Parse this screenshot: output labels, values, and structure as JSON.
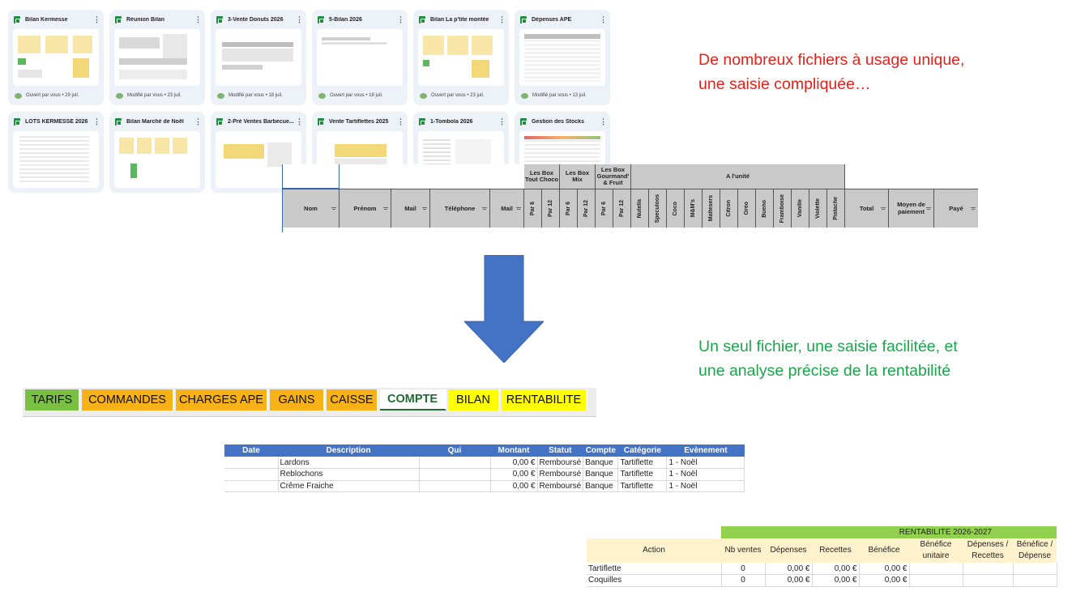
{
  "drive_files": [
    {
      "title": "Bilan Kermesse",
      "meta": "Ouvert par vous • 29 juil."
    },
    {
      "title": "Réunion Bilan",
      "meta": "Modifié par vous • 23 juil."
    },
    {
      "title": "3-Vente Donuts 2026",
      "meta": "Modifié par vous • 18 juil."
    },
    {
      "title": "5-Bilan 2026",
      "meta": "Ouvert par vous • 18 juil."
    },
    {
      "title": "Bilan La p'tite montée",
      "meta": "Ouvert par vous • 23 juil."
    },
    {
      "title": "Dépenses APE",
      "meta": "Modifié par vous • 13 juil."
    },
    {
      "title": "LOTS KERMESSE 2026",
      "meta": ""
    },
    {
      "title": "Bilan Marché de Noël",
      "meta": ""
    },
    {
      "title": "2-Pré Ventes Barbecue...",
      "meta": ""
    },
    {
      "title": "Vente Tartiflettes 2025",
      "meta": ""
    },
    {
      "title": "1-Tombola 2026",
      "meta": ""
    },
    {
      "title": "Gestion des Stocks",
      "meta": ""
    }
  ],
  "order_sheet": {
    "groups": [
      "Les Box Tout Choco",
      "Les Box Mix",
      "Les Box Gourmand' & Fruit",
      "A l'unité"
    ],
    "columns": [
      "Nom",
      "Prénom",
      "Mail",
      "Téléphone",
      "Mail",
      "Par 6",
      "Par 12",
      "Par 6",
      "Par 12",
      "Par 6",
      "Par 12",
      "Nutella",
      "Speculoos",
      "Coco",
      "M&M's",
      "Maltesers",
      "Citron",
      "Oréo",
      "Bueno",
      "Framboise",
      "Vanille",
      "Violette",
      "Pistache",
      "Total",
      "Moyen de paiement",
      "Payé"
    ]
  },
  "captions": {
    "before_line1": "De nombreux fichiers à usage unique,",
    "before_line2": "une saisie compliquée…",
    "after_line1": "Un seul fichier, une saisie facilitée, et",
    "after_line2": "une analyse précise de la rentabilité"
  },
  "tabs": [
    "TARIFS",
    "COMMANDES",
    "CHARGES APE",
    "GAINS",
    "CAISSE",
    "COMPTE",
    "BILAN",
    "RENTABILITE"
  ],
  "compte": {
    "headers": [
      "Date",
      "Description",
      "Qui",
      "Montant",
      "Statut",
      "Compte",
      "Catégorie",
      "Evènement"
    ],
    "rows": [
      [
        "",
        "Lardons",
        "",
        "0,00 €",
        "Remboursé",
        "Banque",
        "Tartiflette",
        "1 - Noël"
      ],
      [
        "",
        "Reblochons",
        "",
        "0,00 €",
        "Remboursé",
        "Banque",
        "Tartiflette",
        "1 - Noël"
      ],
      [
        "",
        "Crême Fraiche",
        "",
        "0,00 €",
        "Remboursé",
        "Banque",
        "Tartiflette",
        "1 - Noël"
      ]
    ]
  },
  "rentabilite": {
    "title": "RENTABILITE 2026-2027",
    "headers": [
      "Action",
      "Nb ventes",
      "Dépenses",
      "Recettes",
      "Bénéfice",
      "Bénéfice unitaire",
      "Dépenses / Recettes",
      "Bénéfice / Dépense"
    ],
    "rows": [
      [
        "Tartiflette",
        "0",
        "0,00 €",
        "0,00 €",
        "0,00 €",
        "",
        "",
        ""
      ],
      [
        "Coquilles",
        "0",
        "0,00 €",
        "0,00 €",
        "0,00 €",
        "",
        "",
        ""
      ]
    ]
  },
  "colors": {
    "tab_green": "#7ac143",
    "tab_orange": "#f8b117",
    "tab_yellow": "#ffff00",
    "table_header_blue": "#4472c4",
    "arrow_blue": "#4472c4",
    "caption_red": "#e8201a",
    "caption_green": "#1aa64a"
  }
}
